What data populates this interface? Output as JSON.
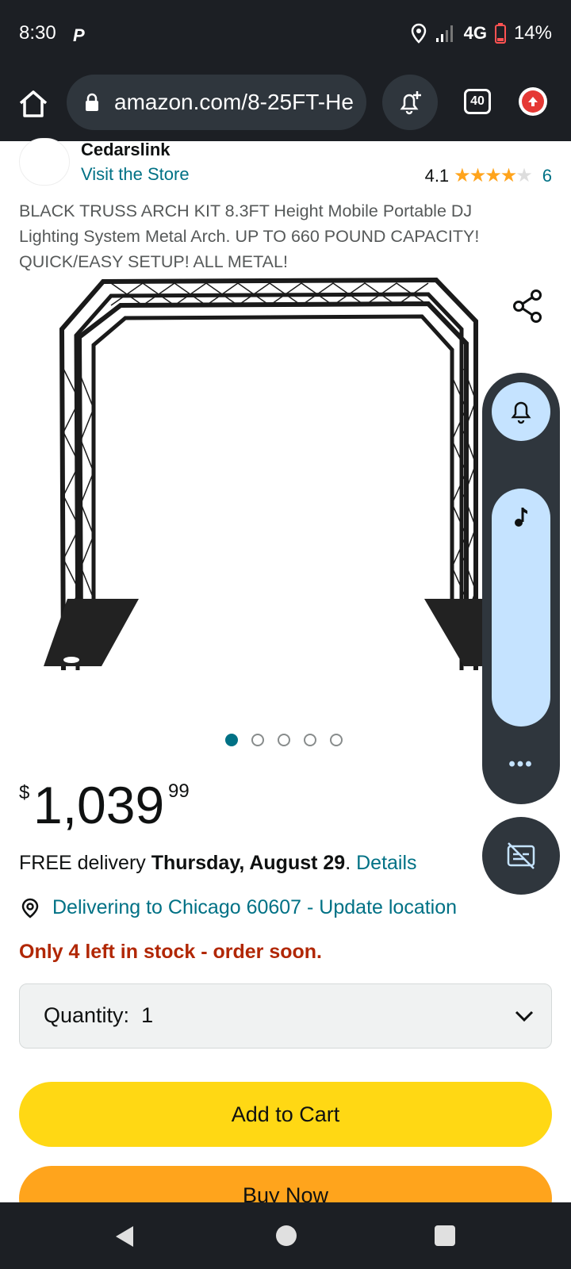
{
  "status_bar": {
    "time": "8:30",
    "network": "4G",
    "battery": "14%"
  },
  "browser": {
    "url": "amazon.com/8-25FT-He",
    "tab_count": "40"
  },
  "store": {
    "name": "Cedarslink",
    "visit_label": "Visit the Store",
    "rating": "4.1",
    "rating_count": "6"
  },
  "product": {
    "title": "BLACK TRUSS ARCH KIT 8.3FT Height Mobile Portable DJ Lighting System Metal Arch. UP TO 660 POUND CAPACITY! QUICK/EASY SETUP! ALL METAL!",
    "image_count": 5,
    "active_image": 0
  },
  "price": {
    "symbol": "$",
    "whole": "1,039",
    "fraction": "99"
  },
  "delivery": {
    "prefix": "FREE delivery ",
    "date": "Thursday, August 29",
    "suffix": ". ",
    "details_link": "Details"
  },
  "location": {
    "text": "Delivering to Chicago 60607 - Update location"
  },
  "stock": {
    "text": "Only 4 left in stock - order soon."
  },
  "quantity": {
    "label": "Quantity:",
    "value": "1"
  },
  "buttons": {
    "add_to_cart": "Add to Cart",
    "buy_now": "Buy Now"
  },
  "float_panel": {
    "more": "•••"
  },
  "colors": {
    "link": "#007185",
    "stock_warning": "#b12704",
    "add_to_cart": "#ffd814",
    "buy_now": "#ffa41c",
    "star": "#ffa41c"
  }
}
